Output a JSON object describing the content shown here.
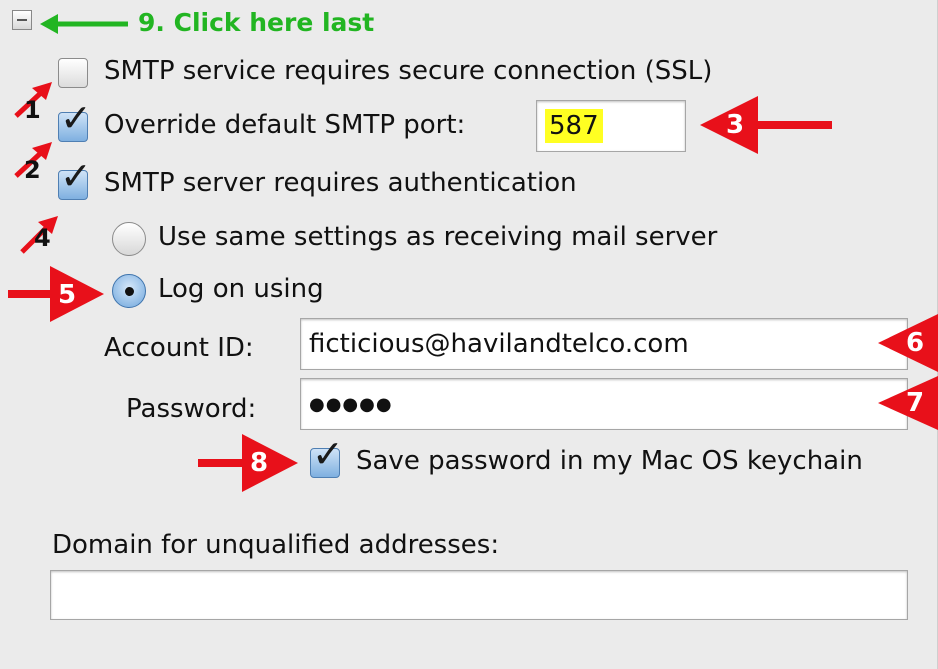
{
  "step9": {
    "label": "9. Click here last"
  },
  "ssl": {
    "label": "SMTP service requires secure connection (SSL)",
    "checked": false
  },
  "override_port": {
    "label": "Override default SMTP port:",
    "checked": true,
    "value": "587"
  },
  "auth": {
    "label": "SMTP server requires authentication",
    "checked": true
  },
  "auth_options": {
    "same_settings_label": "Use same settings as receiving mail server",
    "logon_label": "Log on using",
    "selected": "Log on using"
  },
  "account": {
    "label": "Account ID:",
    "value": "ficticious@havilandtelco.com"
  },
  "password": {
    "label": "Password:",
    "value": "●●●●●"
  },
  "keychain": {
    "label": "Save password in my Mac OS keychain",
    "checked": true
  },
  "domain": {
    "label": "Domain for unqualified addresses:",
    "value": ""
  },
  "annotations": [
    "1",
    "2",
    "3",
    "4",
    "5",
    "6",
    "7",
    "8"
  ],
  "colors": {
    "arrow_red": "#e8101a",
    "annotation_green": "#22b522",
    "highlight": "#ffff22"
  }
}
